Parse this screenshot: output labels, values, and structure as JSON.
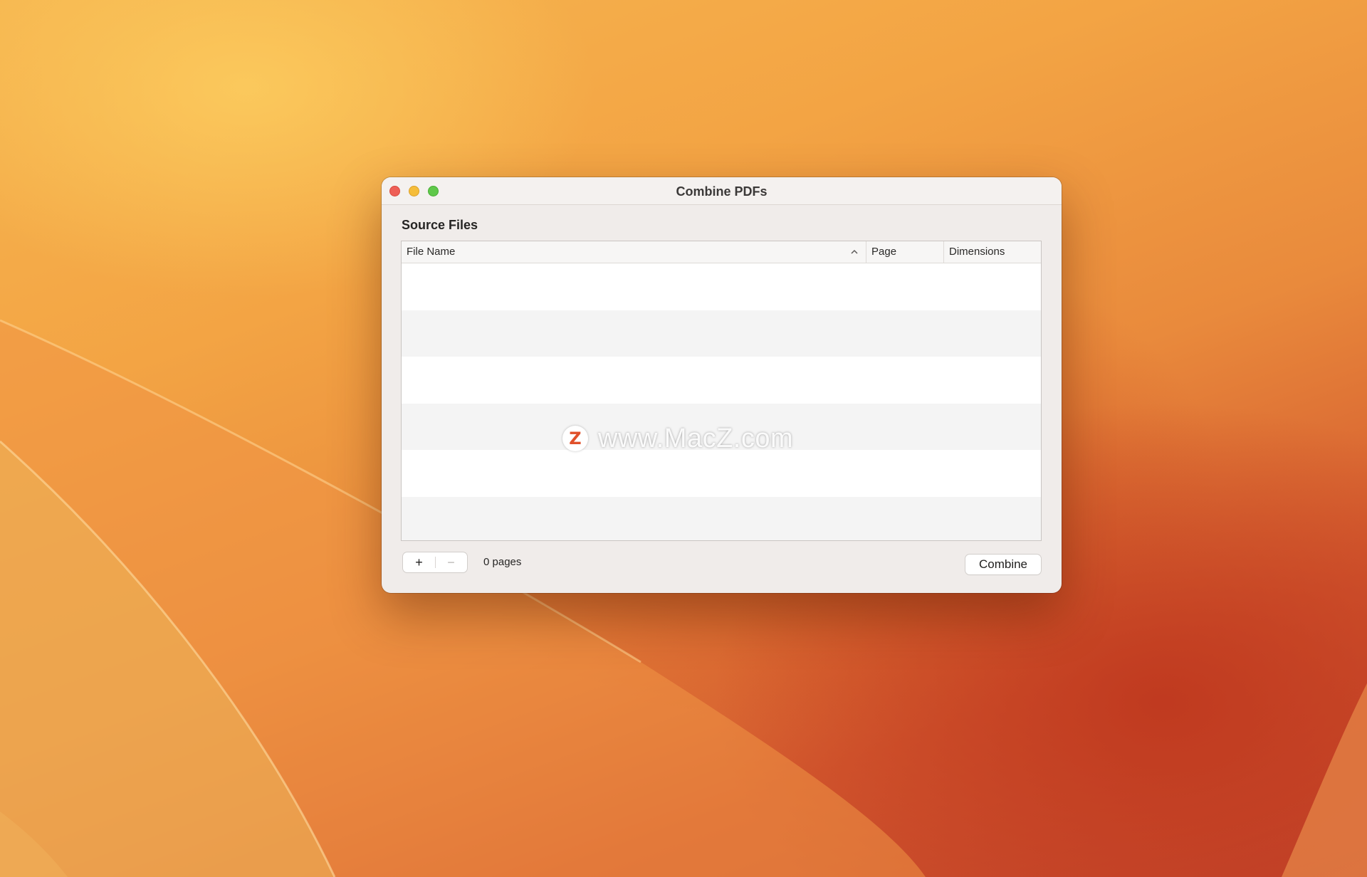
{
  "window": {
    "title": "Combine PDFs",
    "close_label": "close",
    "minimize_label": "minimize",
    "zoom_label": "zoom"
  },
  "source_files": {
    "section_title": "Source Files",
    "columns": {
      "file_name": "File Name",
      "page": "Page",
      "dimensions": "Dimensions"
    },
    "sort_indicator": "^",
    "rows": []
  },
  "footer": {
    "add_label": "+",
    "remove_label": "−",
    "page_count": "0 pages",
    "combine_label": "Combine"
  },
  "watermark": {
    "logo_letter": "Z",
    "text": "www.MacZ.com"
  },
  "icons": {
    "close": "close-icon",
    "minimize": "minimize-icon",
    "zoom": "zoom-icon",
    "sort": "chevron-up-icon"
  },
  "colors": {
    "close": "#ee5f57",
    "minimize": "#f5bd3a",
    "zoom": "#5fc84a",
    "wallpaper_light": "#f6b650",
    "wallpaper_dark": "#c2432a"
  }
}
